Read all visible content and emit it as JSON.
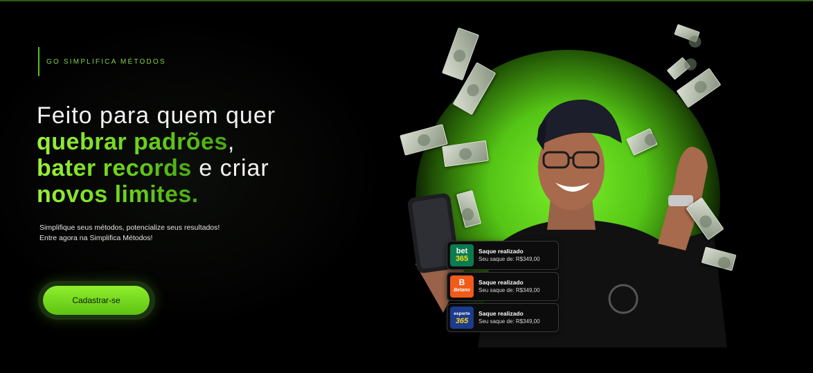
{
  "hero": {
    "eyebrow": "GO SIMPLIFICA MÉTODOS",
    "headline": {
      "line1": "Feito para quem quer",
      "highlight1": "quebrar padrões",
      "comma": ",",
      "highlight2": "bater records",
      "plain2": " e criar",
      "highlight3": "novos limites."
    },
    "subtext": {
      "line1": "Simplifique seus métodos, potencialize seus resultados!",
      "line2": "Entre agora na Simplifica Métodos!"
    },
    "cta_label": "Cadastrar-se"
  },
  "notifications": [
    {
      "brand_a": "bet",
      "brand_b": "365",
      "title": "Saque realizado",
      "detail": "Seu saque de: R$349,00"
    },
    {
      "brand_a": "B",
      "brand_b": "Betano",
      "title": "Saque realizado",
      "detail": "Seu saque de: R$349,00"
    },
    {
      "brand_a": "esporte",
      "brand_b": "365",
      "title": "Saque realizado",
      "detail": "Seu saque de: R$349,00"
    }
  ],
  "colors": {
    "accent": "#6ad31a",
    "accent_light": "#9cf23a",
    "background": "#000000",
    "card_background": "#0c0c0c"
  },
  "icons": [
    "money-bill-icon",
    "smartphone-icon",
    "bet365-logo-icon",
    "betano-logo-icon",
    "esporte365-logo-icon"
  ]
}
